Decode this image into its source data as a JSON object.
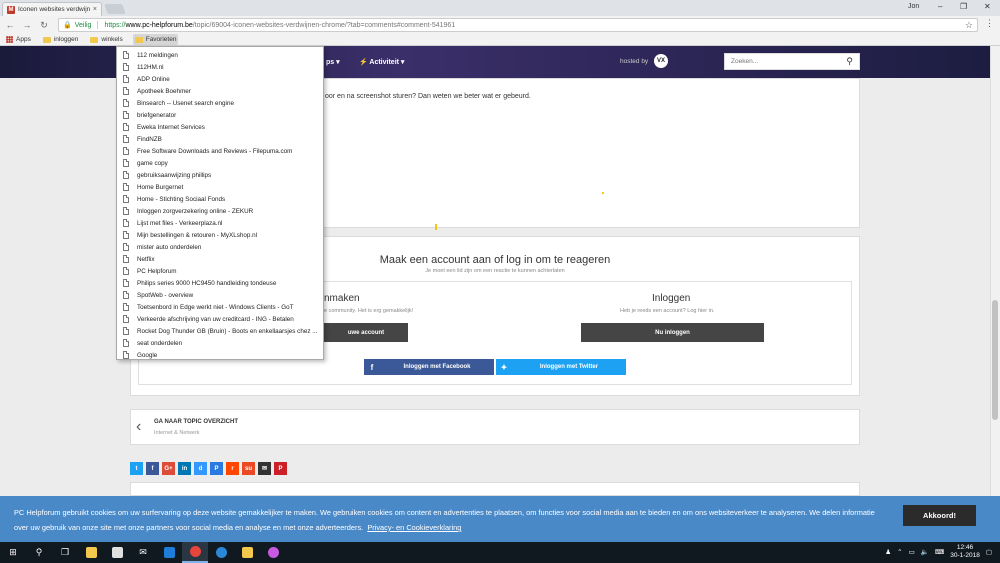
{
  "browser": {
    "tab_title": "Iconen websites verdwijne",
    "tab_favicon": "M",
    "user": "Jon",
    "secure_label": "Veilig",
    "url_scheme": "https://",
    "url_host": "www.pc-helpforum.be",
    "url_path": "/topic/69004-iconen-websites-verdwijnen-chrome/?tab=comments#comment-541961"
  },
  "bookmarks_bar": {
    "items": [
      "Apps",
      "inloggen",
      "winkels",
      "Favorieten"
    ]
  },
  "bookmark_dropdown": {
    "items": [
      "112 meldingen",
      "112HM.nl",
      "ADP Online",
      "Apotheek Boehmer",
      "Binsearch -- Usenet search engine",
      "briefgenerator",
      "Eweka Internet Services",
      "FindNZB",
      "Free Software Downloads and Reviews - Filepuma.com",
      "game copy",
      "gebruiksaanwijzing phillips",
      "Home  Burgernet",
      "Home - Stichting Sociaal Fonds",
      "Inloggen zorgverzekering online - ZEKUR",
      "Lijst met files - Verkeerplaza.nl",
      "Mijn bestellingen & retouren - MyXLshop.nl",
      "mister auto onderdelen",
      "Netflix",
      "PC Helpforum",
      "Philips series 9000 HC9450 handleiding tondeuse",
      "SpotWeb - overview",
      "Toetsenbord in Edge werkt niet - Windows Clients - GoT",
      "Verkeerde afschrijving van uw creditcard - ING - Betalen",
      "Rocket Dog Thunder GB (Bruin) - Boots en enkellaarsjes chez ...",
      "seat onderdelen",
      "Google"
    ]
  },
  "site": {
    "nav_apps": "ps ▾",
    "nav_activity": "Activiteit ▾",
    "hosted_by": "hosted by",
    "vx_logo": "VX",
    "search_placeholder": "Zoeken...",
    "post_text": "oor en na screenshot sturen? Dan weten we beter wat er gebeurd.",
    "register_title": "Maak een account aan of log in om te reageren",
    "register_sub": "Je moet een lid zijn om een reactie te kunnen achterlaten",
    "create_title": "nmaken",
    "create_sub": "e community. Het is erg gemakkelijk!",
    "create_button": "uwe account",
    "login_title": "Inloggen",
    "login_sub": "Heb je reeds een account? Log hier in.",
    "login_button": "Nu inloggen",
    "facebook_button": "Inloggen met Facebook",
    "twitter_button": "Inloggen met Twitter",
    "back_title": "GA NAAR TOPIC OVERZICHT",
    "back_sub": "Internet & Netwerk"
  },
  "share_icons": [
    {
      "name": "twitter-icon",
      "glyph": "t",
      "color": "#1da1f2"
    },
    {
      "name": "facebook-icon",
      "glyph": "f",
      "color": "#3b5998"
    },
    {
      "name": "google-plus-icon",
      "glyph": "G+",
      "color": "#dd4b39"
    },
    {
      "name": "linkedin-icon",
      "glyph": "in",
      "color": "#0077b5"
    },
    {
      "name": "delicious-icon",
      "glyph": "d",
      "color": "#3399ff"
    },
    {
      "name": "pinterest-alt-icon",
      "glyph": "P",
      "color": "#2a7ae2"
    },
    {
      "name": "reddit-icon",
      "glyph": "r",
      "color": "#ff4500"
    },
    {
      "name": "stumbleupon-icon",
      "glyph": "su",
      "color": "#eb4924"
    },
    {
      "name": "email-icon",
      "glyph": "✉",
      "color": "#333333"
    },
    {
      "name": "pinterest-icon",
      "glyph": "P",
      "color": "#cb2027"
    }
  ],
  "cookie_bar": {
    "text": "PC Helpforum gebruikt cookies om uw surfervaring op deze website gemakkelijker te maken. We gebruiken cookies om content en advertenties te plaatsen, om functies voor social media aan te bieden en om ons websiteverkeer te analyseren. We delen informatie over uw gebruik van onze site met onze partners voor social media en analyse en met onze adverteerders.",
    "link": "Privacy- en Cookieverklaring",
    "accept_button": "Akkoord!"
  },
  "taskbar": {
    "time": "12:46",
    "date": "30-1-2018"
  },
  "colors": {
    "cookie_bg": "#4a89c8",
    "facebook": "#3b5998",
    "twitter": "#1da1f2",
    "header_bg": "#2b2350"
  }
}
